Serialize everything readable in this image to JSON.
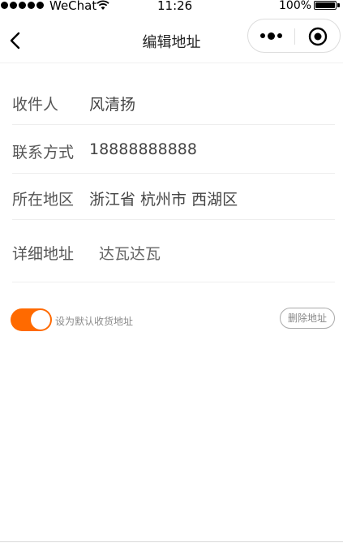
{
  "status_bar": {
    "carrier": "WeChat",
    "time": "11:26",
    "battery_percent": "100%"
  },
  "nav": {
    "title": "编辑地址",
    "back_icon": "chevron-left-icon",
    "more_icon": "more-dots-icon",
    "close_icon": "target-circle-icon"
  },
  "form": {
    "name": {
      "label": "收件人",
      "value": "风清扬"
    },
    "phone": {
      "label": "联系方式",
      "value": "18888888888"
    },
    "region": {
      "label": "所在地区",
      "value": "浙江省 杭州市 西湖区"
    },
    "detail": {
      "label": "详细地址",
      "value": "达瓦达瓦"
    }
  },
  "actions": {
    "default_toggle_on": true,
    "default_label": "设为默认收货地址",
    "delete_label": "删除地址"
  },
  "colors": {
    "accent": "#ff6a00",
    "text": "#333333",
    "muted": "#8a8a8a",
    "divider": "#eeeeee"
  }
}
